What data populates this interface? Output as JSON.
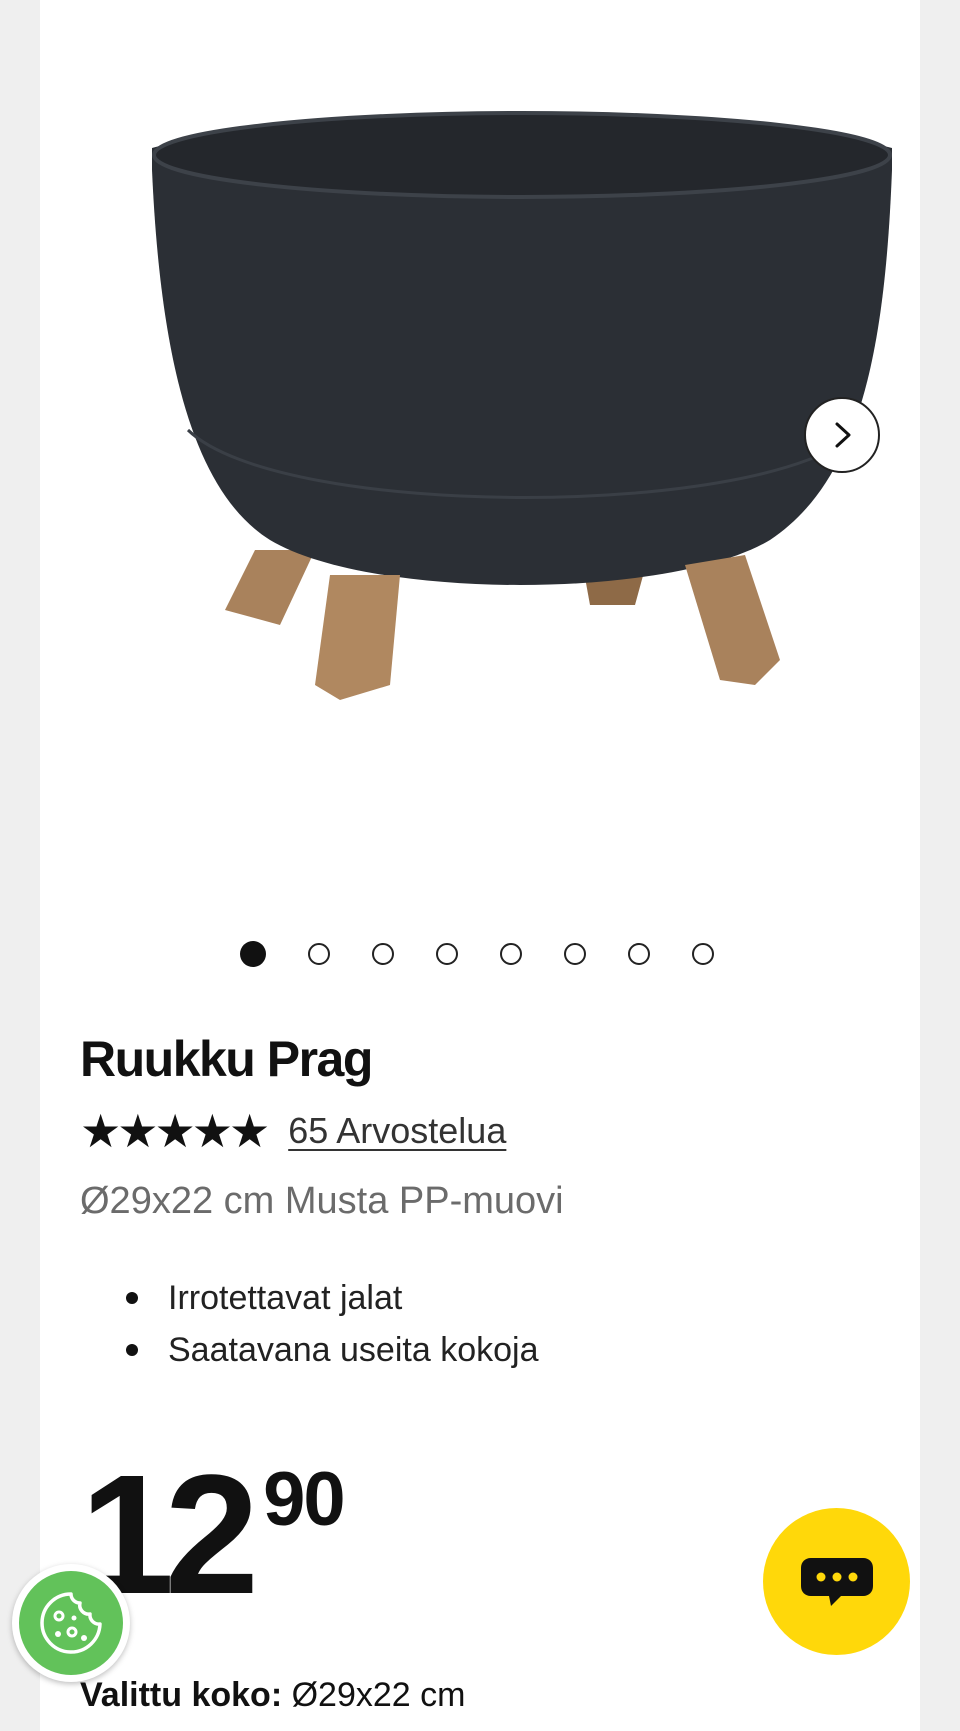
{
  "product": {
    "title": "Ruukku Prag",
    "rating": {
      "stars": "★★★★★",
      "value": 5,
      "max": 5,
      "reviews_link": "65 Arvostelua"
    },
    "subtitle": "Ø29x22 cm Musta PP-muovi",
    "features": [
      "Irrotettavat jalat",
      "Saatavana useita kokoja"
    ],
    "price": {
      "main": "12",
      "cents": "90"
    },
    "selected_size": {
      "label": "Valittu koko:",
      "value": "Ø29x22 cm"
    }
  },
  "gallery": {
    "image_count": 8,
    "active_index": 0,
    "image_icon": "flower-pot-with-legs-image",
    "next_icon": "chevron-right-icon"
  },
  "colors": {
    "chat_button": "#ffd80a",
    "cookie_button": "#62c25a",
    "pot": "#2b2f35",
    "legs": "#a9825c"
  },
  "icons": {
    "chat": "chat-bubble-icon",
    "cookie": "cookie-icon"
  }
}
